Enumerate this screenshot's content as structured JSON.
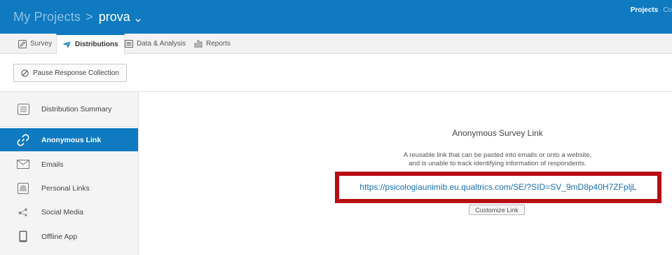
{
  "header": {
    "root_label": "My Projects",
    "separator": ">",
    "current_project": "prova",
    "right_links": {
      "projects": "Projects",
      "more": "Co"
    }
  },
  "tabs": [
    {
      "label": "Survey",
      "icon": "pencil-icon"
    },
    {
      "label": "Distributions",
      "icon": "paper-plane-icon"
    },
    {
      "label": "Data & Analysis",
      "icon": "table-icon"
    },
    {
      "label": "Reports",
      "icon": "bar-chart-icon"
    }
  ],
  "toolbar": {
    "pause_label": "Pause Response Collection"
  },
  "sidebar": {
    "items": [
      {
        "label": "Distribution Summary",
        "icon": "summary-icon"
      },
      {
        "label": "Anonymous Link",
        "icon": "link-icon"
      },
      {
        "label": "Emails",
        "icon": "envelope-icon"
      },
      {
        "label": "Personal Links",
        "icon": "fingerprint-icon"
      },
      {
        "label": "Social Media",
        "icon": "share-icon"
      },
      {
        "label": "Offline App",
        "icon": "tablet-icon"
      }
    ]
  },
  "main": {
    "title": "Anonymous Survey Link",
    "description_line1": "A reusable link that can be pasted into emails or onto a website,",
    "description_line2": "and is unable to track identifying information of respondents.",
    "link": "https://psicologiaunimib.eu.qualtrics.com/SE/?SID=SV_9mD8p40H7ZFpljL",
    "customize_label": "Customize Link"
  },
  "colors": {
    "brand": "#0f7ac0",
    "highlight": "#b80d14",
    "link": "#1a6fb0"
  }
}
